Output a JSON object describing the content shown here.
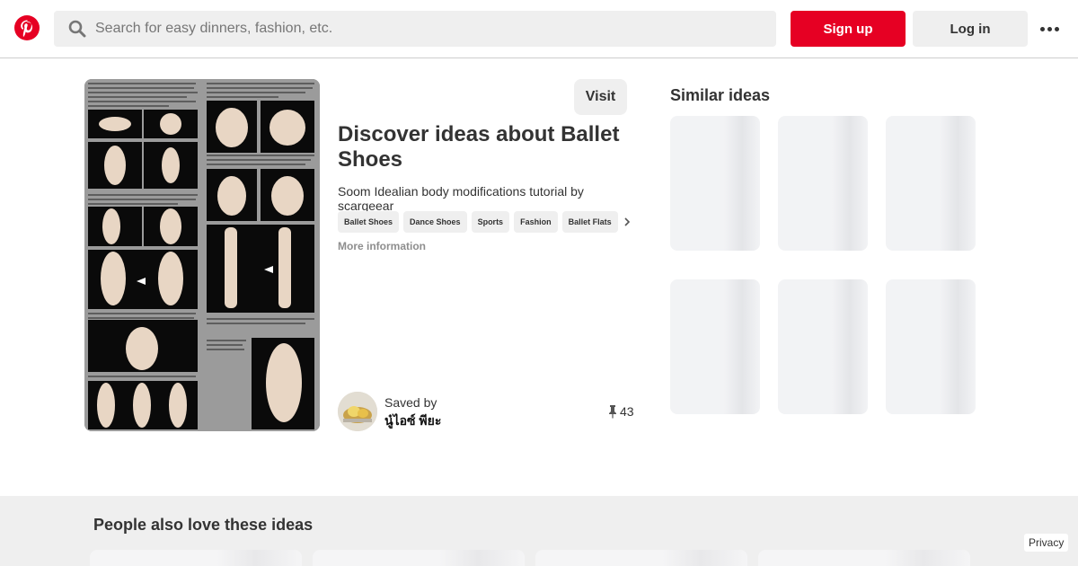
{
  "header": {
    "search_placeholder": "Search for easy dinners, fashion, etc.",
    "signup_label": "Sign up",
    "login_label": "Log in",
    "logo_icon": "pinterest-logo",
    "brand_color": "#e60023"
  },
  "pin": {
    "visit_label": "Visit",
    "title": "Discover ideas about Ballet Shoes",
    "description": "Soom Idealian body modifications tutorial by scargeear",
    "tags": [
      "Ballet Shoes",
      "Dance Shoes",
      "Sports",
      "Fashion",
      "Ballet Flats"
    ],
    "more_info_label": "More information",
    "saved_by_label": "Saved by",
    "saver_name": "นู๋ไอซ์ พียะ",
    "save_count": "43"
  },
  "similar": {
    "title": "Similar ideas"
  },
  "people_also_love": {
    "title": "People also love these ideas"
  },
  "privacy_label": "Privacy"
}
